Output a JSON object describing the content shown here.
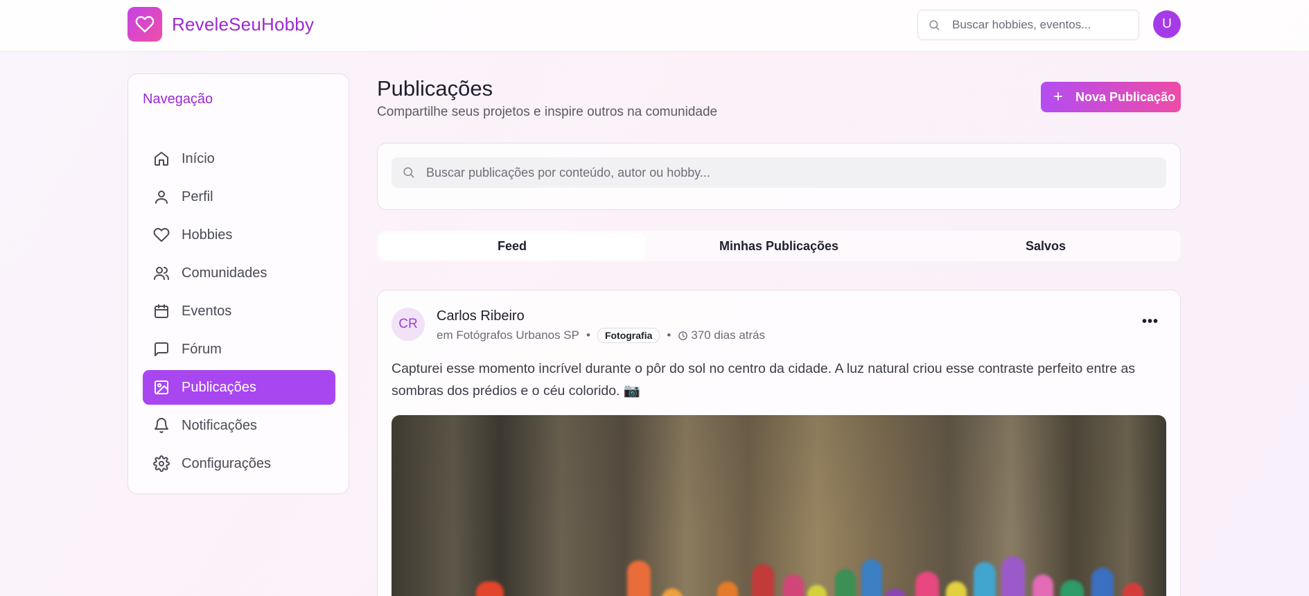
{
  "header": {
    "brand": "ReveleSeuHobby",
    "search_placeholder": "Buscar hobbies, eventos...",
    "avatar_initial": "U"
  },
  "sidebar": {
    "title": "Navegação",
    "items": [
      {
        "label": "Início",
        "icon": "home-icon"
      },
      {
        "label": "Perfil",
        "icon": "user-icon"
      },
      {
        "label": "Hobbies",
        "icon": "heart-icon"
      },
      {
        "label": "Comunidades",
        "icon": "users-icon"
      },
      {
        "label": "Eventos",
        "icon": "calendar-icon"
      },
      {
        "label": "Fórum",
        "icon": "message-square-icon"
      },
      {
        "label": "Publicações",
        "icon": "image-icon",
        "active": true
      },
      {
        "label": "Notificações",
        "icon": "bell-icon"
      },
      {
        "label": "Configurações",
        "icon": "gear-icon"
      }
    ]
  },
  "main": {
    "title": "Publicações",
    "subtitle": "Compartilhe seus projetos e inspire outros na comunidade",
    "new_button_label": "Nova Publicação",
    "search_placeholder": "Buscar publicações por conteúdo, autor ou hobby...",
    "tabs": [
      {
        "label": "Feed",
        "active": true
      },
      {
        "label": "Minhas Publicações"
      },
      {
        "label": "Salvos"
      }
    ]
  },
  "post": {
    "avatar_initials": "CR",
    "author": "Carlos Ribeiro",
    "community": "em Fotógrafos Urbanos SP",
    "hobby_badge": "Fotografia",
    "time_ago": "370 dias atrás",
    "text": "Capturei esse momento incrível durante o pôr do sol no centro da cidade. A luz natural criou esse contraste perfeito entre as sombras dos prédios e o céu colorido. 📷"
  },
  "colors": {
    "brand_purple": "#9a2ad1",
    "active_nav": "#a846f0",
    "gradient_start": "#b44cf2",
    "gradient_end": "#ee4ca6"
  }
}
